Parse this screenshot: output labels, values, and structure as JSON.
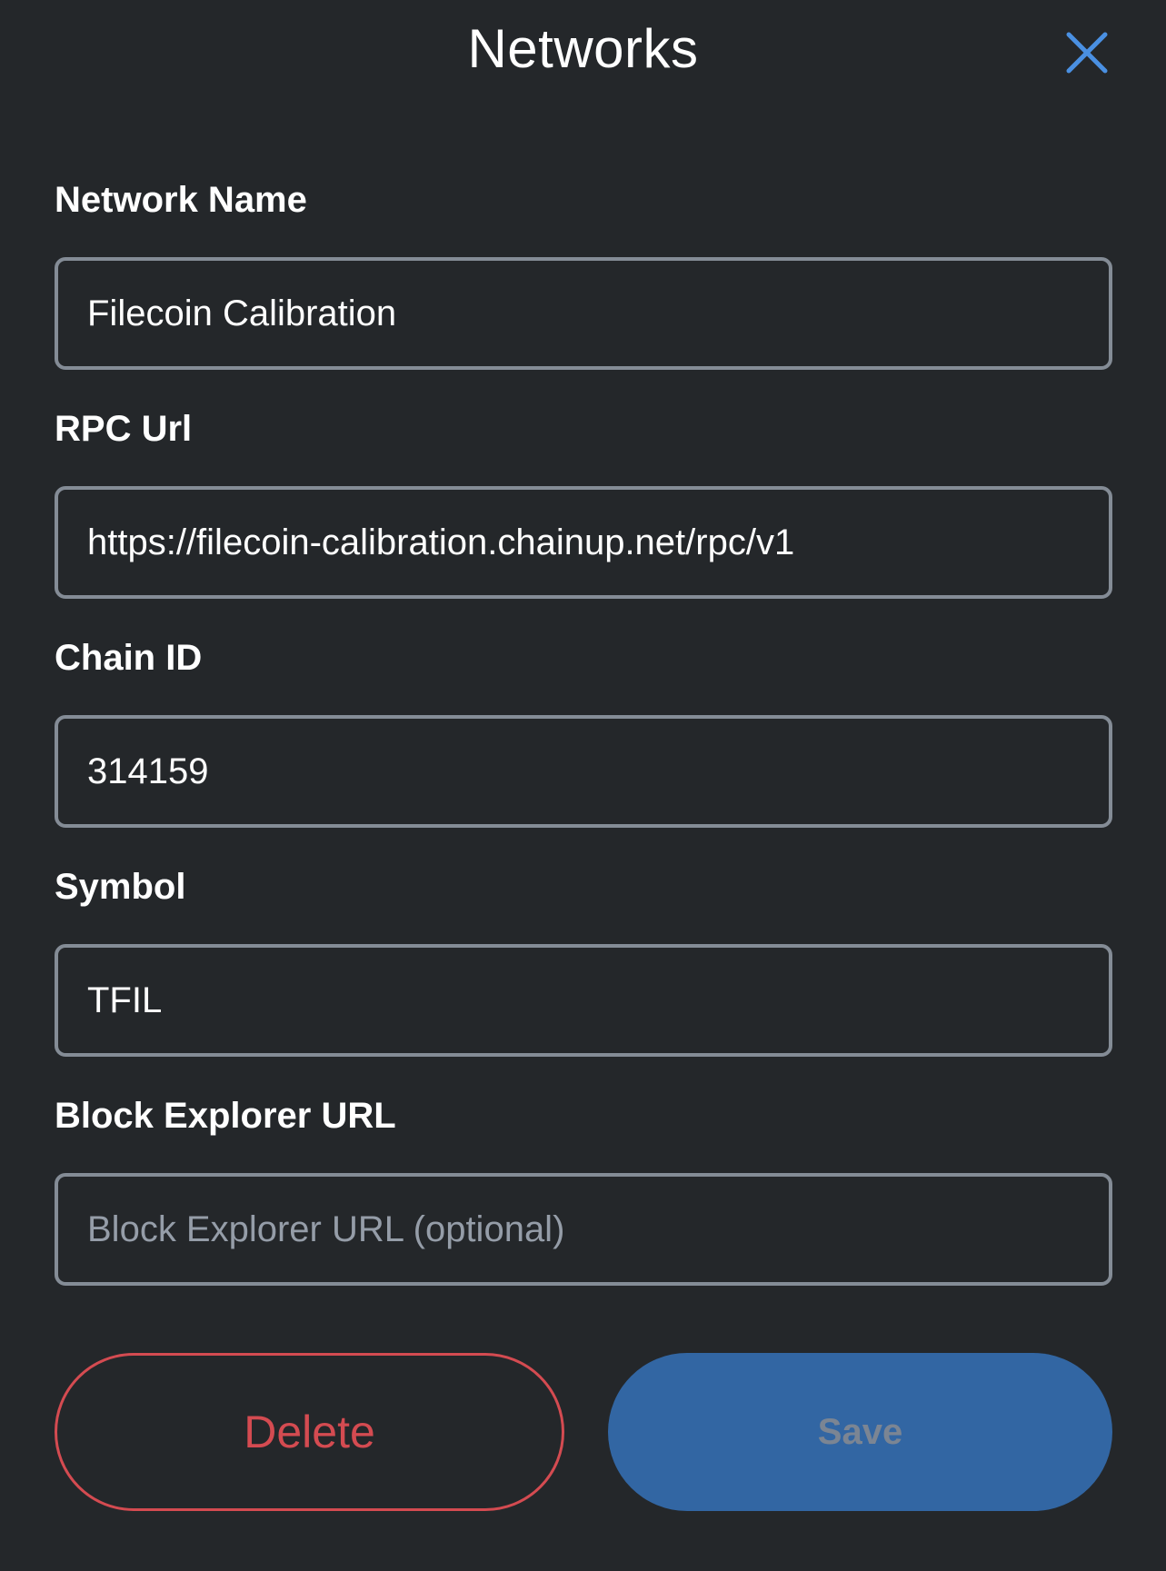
{
  "header": {
    "title": "Networks",
    "close_icon": "close-icon",
    "close_color": "#4a90e2"
  },
  "form": {
    "network_name": {
      "label": "Network Name",
      "value": "Filecoin Calibration",
      "placeholder": ""
    },
    "rpc_url": {
      "label": "RPC Url",
      "value": "https://filecoin-calibration.chainup.net/rpc/v1",
      "placeholder": ""
    },
    "chain_id": {
      "label": "Chain ID",
      "value": "314159",
      "placeholder": ""
    },
    "symbol": {
      "label": "Symbol",
      "value": "TFIL",
      "placeholder": ""
    },
    "block_explorer_url": {
      "label": "Block Explorer URL",
      "value": "",
      "placeholder": "Block Explorer URL (optional)"
    }
  },
  "actions": {
    "delete_label": "Delete",
    "save_label": "Save",
    "delete_color": "#d44b51",
    "save_color": "#3266a3"
  }
}
